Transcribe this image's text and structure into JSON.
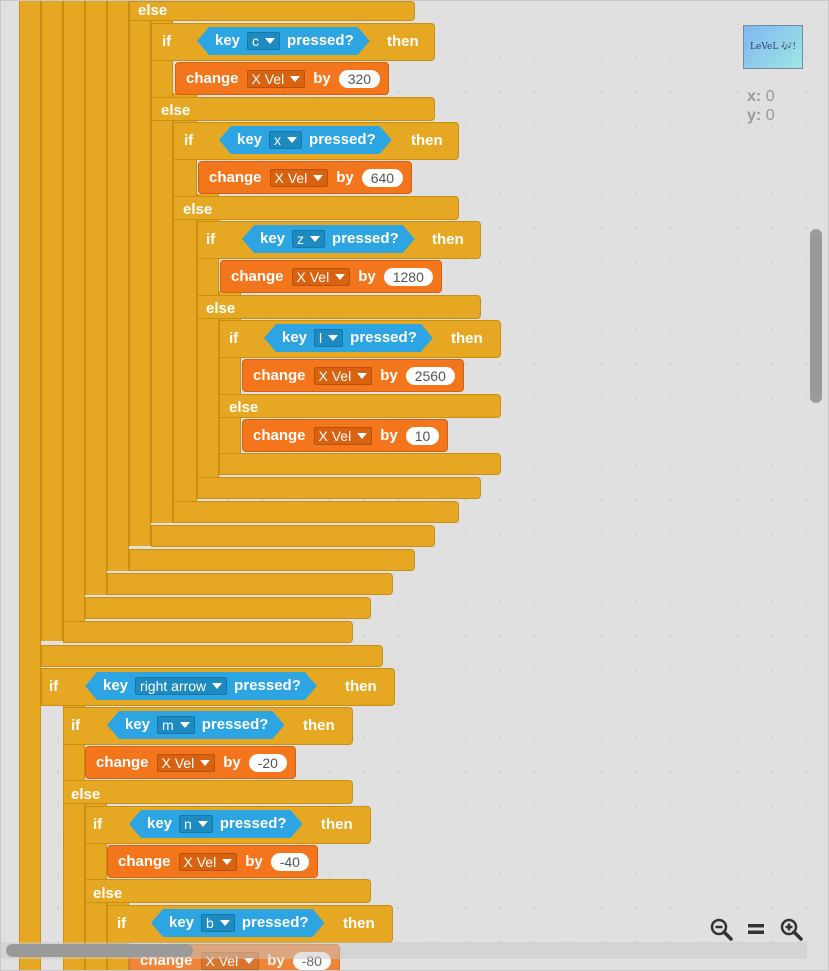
{
  "labels": {
    "if": "if",
    "else": "else",
    "then": "then",
    "key": "key",
    "pressed": "pressed?",
    "change": "change",
    "by": "by"
  },
  "blocks": [
    {
      "id": "c",
      "key": "c",
      "variable": "X Vel",
      "amount": "320"
    },
    {
      "id": "x",
      "key": "x",
      "variable": "X Vel",
      "amount": "640"
    },
    {
      "id": "z",
      "key": "z",
      "variable": "X Vel",
      "amount": "1280"
    },
    {
      "id": "l",
      "key": "l",
      "variable": "X Vel",
      "amount": "2560"
    },
    {
      "id": "else10",
      "variable": "X Vel",
      "amount": "10"
    },
    {
      "id": "right",
      "key": "right arrow"
    },
    {
      "id": "m",
      "key": "m",
      "variable": "X Vel",
      "amount": "-20"
    },
    {
      "id": "n",
      "key": "n",
      "variable": "X Vel",
      "amount": "-40"
    },
    {
      "id": "b",
      "key": "b",
      "variable": "X Vel",
      "amount": "-80"
    }
  ],
  "sprite_thumbnail": {
    "caption": "LeVeL 🎶!"
  },
  "coords": {
    "x_label": "x:",
    "x_value": "0",
    "y_label": "y:",
    "y_value": "0"
  },
  "zoom": {
    "zoom_out": "zoom-out-icon",
    "reset": "zoom-reset-icon",
    "zoom_in": "zoom-in-icon"
  },
  "colors": {
    "control": "#e6a822",
    "sensing": "#2ca5e2",
    "data": "#f3761d",
    "workspace": "#e0e0e0"
  }
}
